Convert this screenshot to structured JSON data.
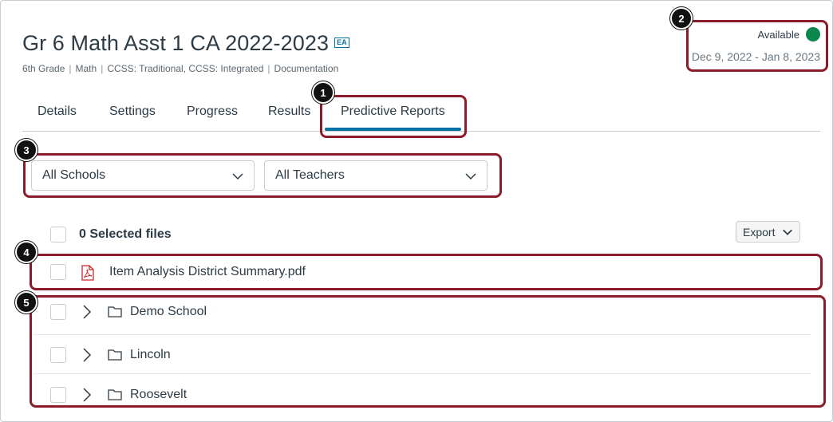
{
  "header": {
    "title": "Gr 6 Math Asst 1 CA 2022-2023",
    "badge": "EA",
    "subtitle_items": [
      "6th Grade",
      "Math",
      "CCSS: Traditional, CCSS: Integrated",
      "Documentation"
    ]
  },
  "availability": {
    "label": "Available",
    "dates": "Dec 9, 2022 - Jan 8, 2023",
    "status_color": "#0b874b"
  },
  "tabs": [
    {
      "label": "Details"
    },
    {
      "label": "Settings"
    },
    {
      "label": "Progress"
    },
    {
      "label": "Results"
    },
    {
      "label": "Predictive Reports",
      "active": true
    }
  ],
  "filters": {
    "schools": "All Schools",
    "teachers": "All Teachers"
  },
  "files": {
    "selected_label": "0 Selected files",
    "export_label": "Export",
    "pdf_name": "Item Analysis District Summary.pdf",
    "folders": [
      "Demo School",
      "Lincoln",
      "Roosevelt"
    ]
  },
  "annotations": [
    "1",
    "2",
    "3",
    "4",
    "5"
  ],
  "colors": {
    "accent": "#0770a3",
    "highlight": "#8b1c2b",
    "pdf_icon": "#d0222c"
  }
}
